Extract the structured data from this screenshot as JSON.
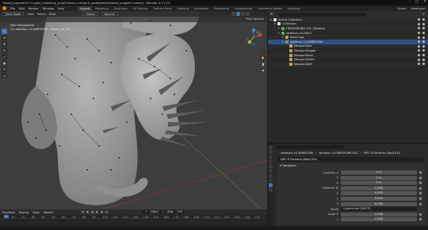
{
  "window": {
    "title": "*lizard_puppet010 (Cryptic_modeling)_proj01\\lizard_cre\\work_posit\\blender\\lizard_puppet01.blend] - Blender 4.1.1 (T)",
    "controls": [
      "–",
      "□",
      "✕"
    ]
  },
  "menubar": {
    "items": [
      "File",
      "Edit",
      "Render",
      "Window",
      "Help"
    ],
    "workspaces": [
      "Layout",
      "Modeling",
      "Sculpting",
      "UV Editing",
      "Texture Paint",
      "Shading",
      "Animation",
      "Rendering",
      "Compositing",
      "Geometry Nodes",
      "Scripting"
    ],
    "active_workspace": "Layout",
    "scene": "Scene",
    "view_layer": "ViewLayer"
  },
  "viewport": {
    "mode": "Pose Mode",
    "menus": [
      "View",
      "Select",
      "Pose"
    ],
    "orientation": "Global",
    "pivot": "Normal",
    "overlay_label": "Pose Options",
    "info_line1": "User Perspective",
    "info_line2": "(1) skeleton.14.WIREFUNK - Stikes_Sb_OR...",
    "gizmo_axes": [
      "X",
      "Y",
      "Z"
    ],
    "colors": {
      "x": "#f04a5f",
      "y": "#8bd83f",
      "z": "#4f8ef0",
      "bone": "#101010",
      "grid_red": "#8a3a3a",
      "grid_green": "#5f7a3a"
    }
  },
  "timeline": {
    "menus": [
      "Playback",
      "Keying",
      "View",
      "Marker"
    ],
    "current_frame": "1",
    "start_label": "Start",
    "start": "1",
    "end_label": "End",
    "end": "250",
    "ruler_ticks": [
      "10",
      "20",
      "30",
      "40",
      "50",
      "60",
      "70",
      "80",
      "90",
      "100",
      "110",
      "120",
      "130",
      "140",
      "150",
      "160",
      "170",
      "180",
      "190",
      "200",
      "210",
      "220",
      "230",
      "240",
      "250"
    ]
  },
  "outliner": {
    "rows": [
      {
        "label": "Scene Collection",
        "depth": 0,
        "icon": "collection-icon",
        "color": "#dddddd",
        "selected": false
      },
      {
        "label": "Collection",
        "depth": 1,
        "icon": "collection-icon",
        "color": "#dddddd",
        "selected": false
      },
      {
        "label": "ORIGINSKINN 19L_Skeleton",
        "depth": 2,
        "icon": "armature-icon",
        "color": "#dddddd",
        "selected": false
      },
      {
        "label": "skeleton.14.DISCT",
        "depth": 2,
        "icon": "armature-icon",
        "color": "#dddddd",
        "selected": false
      },
      {
        "label": "Rebel bgs",
        "depth": 3,
        "icon": "bone-icon",
        "color": "#dddddd",
        "selected": false
      },
      {
        "label": "skeleton.14.WIREFUNK",
        "depth": 3,
        "icon": "armature-icon",
        "color": "#dddddd",
        "selected": true
      },
      {
        "label": "WeaponHost",
        "depth": 4,
        "icon": "bone-icon",
        "color": "#dddddd",
        "selected": false
      },
      {
        "label": "WeaponDagger",
        "depth": 4,
        "icon": "bone-icon",
        "color": "#dddddd",
        "selected": false
      },
      {
        "label": "WeaponMace",
        "depth": 4,
        "icon": "bone-icon",
        "color": "#dddddd",
        "selected": false
      },
      {
        "label": "WeaponShield",
        "depth": 4,
        "icon": "bone-icon",
        "color": "#dddddd",
        "selected": false
      },
      {
        "label": "WeaponStaff",
        "depth": 4,
        "icon": "bone-icon",
        "color": "#dddddd",
        "selected": false
      }
    ]
  },
  "properties": {
    "breadcrumb": [
      "skeleton.14.WIREFUNK",
      "skeleton.14.WIREFUNK.001",
      "NPC R Forearm (Rod).014"
    ],
    "name_field": "NPC R Forearm (Rod).014",
    "panel_title": "Transform",
    "fields": [
      {
        "label": "Location X",
        "value": "0 m"
      },
      {
        "label": "Y",
        "value": "0 m"
      },
      {
        "label": "Z",
        "value": "0 m"
      },
      {
        "label": "Rotation W",
        "value": "1.000"
      },
      {
        "label": "X",
        "value": "0.000"
      },
      {
        "label": "Y",
        "value": "0.000"
      },
      {
        "label": "Z",
        "value": "0.000"
      },
      {
        "label": "Mode",
        "value": "Quaternion (WXYZ)"
      },
      {
        "label": "Scale X",
        "value": "1.000"
      },
      {
        "label": "Y",
        "value": "1.000"
      }
    ]
  }
}
